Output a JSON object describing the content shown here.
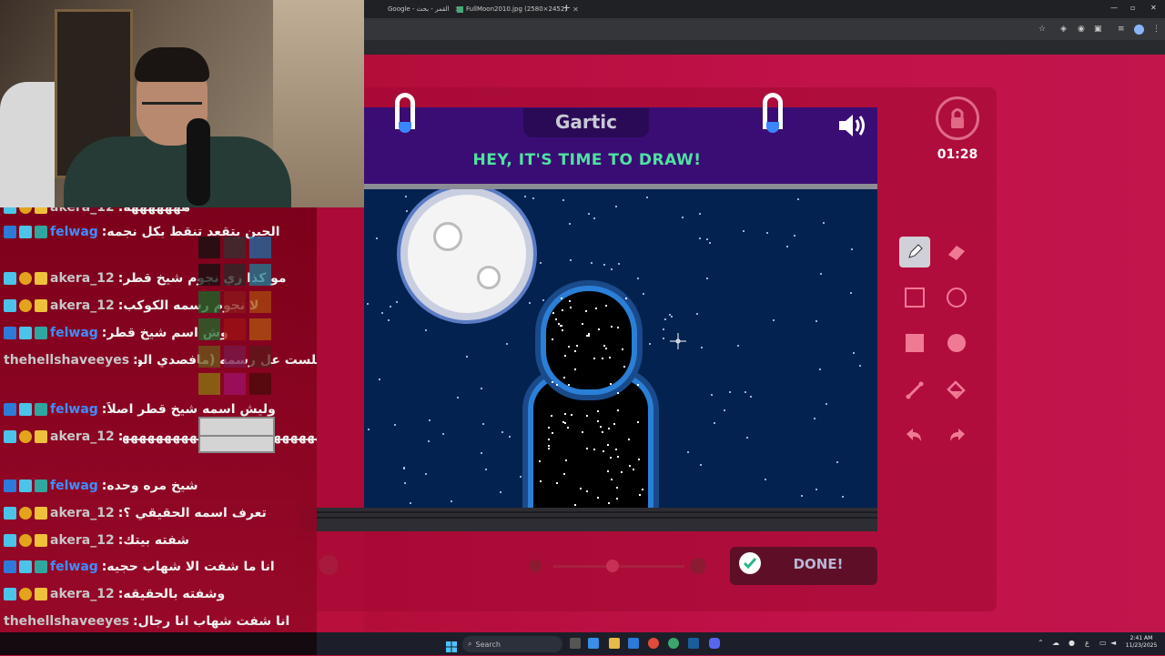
{
  "browser": {
    "tabs": [
      {
        "label": "Google - القمر - بحث"
      },
      {
        "label": "FullMoon2010.jpg (2580×2452)"
      }
    ],
    "new_tab": "+",
    "window_controls": {
      "minimize": "—",
      "maximize": "▫",
      "close": "✕"
    }
  },
  "game": {
    "logo": "Gartic",
    "title": "HEY, IT'S TIME TO DRAW!",
    "timer": "01:28",
    "done_label": "DONE!",
    "brush_size": 0.45
  },
  "tools": [
    {
      "name": "pencil-tool"
    },
    {
      "name": "eraser-tool"
    },
    {
      "name": "rectangle-outline-tool"
    },
    {
      "name": "ellipse-outline-tool"
    },
    {
      "name": "rectangle-fill-tool"
    },
    {
      "name": "ellipse-fill-tool"
    },
    {
      "name": "line-tool"
    },
    {
      "name": "fill-bucket-tool"
    },
    {
      "name": "undo-tool"
    },
    {
      "name": "redo-tool"
    }
  ],
  "colors": {
    "accent": "#4fe3a0",
    "header": "#3a0d75",
    "canvas": "#032250",
    "background": "#b80f3c",
    "username_felwag": "#3d8eff"
  },
  "chat": {
    "messages": [
      {
        "user": "akera_12",
        "text": "هههههههه",
        "badges": "subscriber"
      },
      {
        "user": "felwag",
        "text": "الحين بتقعد تنقط بكل نجمه",
        "badges": "moderator"
      },
      {
        "user": "akera_12",
        "text": "مو كذا زي نجوم شيخ قطر",
        "badges": "subscriber"
      },
      {
        "user": "akera_12",
        "text": "لا نجوم رسمه الكوكب",
        "badges": "subscriber"
      },
      {
        "user": "felwag",
        "text": "وش اسم شيخ قطر",
        "badges": "moderator"
      },
      {
        "user": "thehellshaveeyes",
        "text": "كم جلست عل رسمه (مافصدي الوقت)",
        "badges": "none"
      },
      {
        "user": "felwag",
        "text": "وليش اسمه شيخ قطر اصلاً",
        "badges": "moderator"
      },
      {
        "user": "akera_12",
        "text": "هههههههههههههههههههههههههههههههههه",
        "badges": "subscriber"
      },
      {
        "user": "felwag",
        "text": "شيخ مره وحده",
        "badges": "moderator"
      },
      {
        "user": "akera_12",
        "text": "تعرف اسمه الحقيقي ؟",
        "badges": "subscriber"
      },
      {
        "user": "akera_12",
        "text": "شفته بيتك",
        "badges": "subscriber"
      },
      {
        "user": "felwag",
        "text": "انا ما شفت الا شهاب حجيه",
        "badges": "moderator"
      },
      {
        "user": "akera_12",
        "text": "وشفته بالحقيقه",
        "badges": "subscriber"
      },
      {
        "user": "thehellshaveeyes",
        "text": "انا شفت شهاب انا رجال",
        "badges": "none"
      }
    ]
  },
  "taskbar": {
    "search_label": "Search",
    "time": "2:41 AM",
    "date": "11/23/2025",
    "lang": "ع"
  }
}
